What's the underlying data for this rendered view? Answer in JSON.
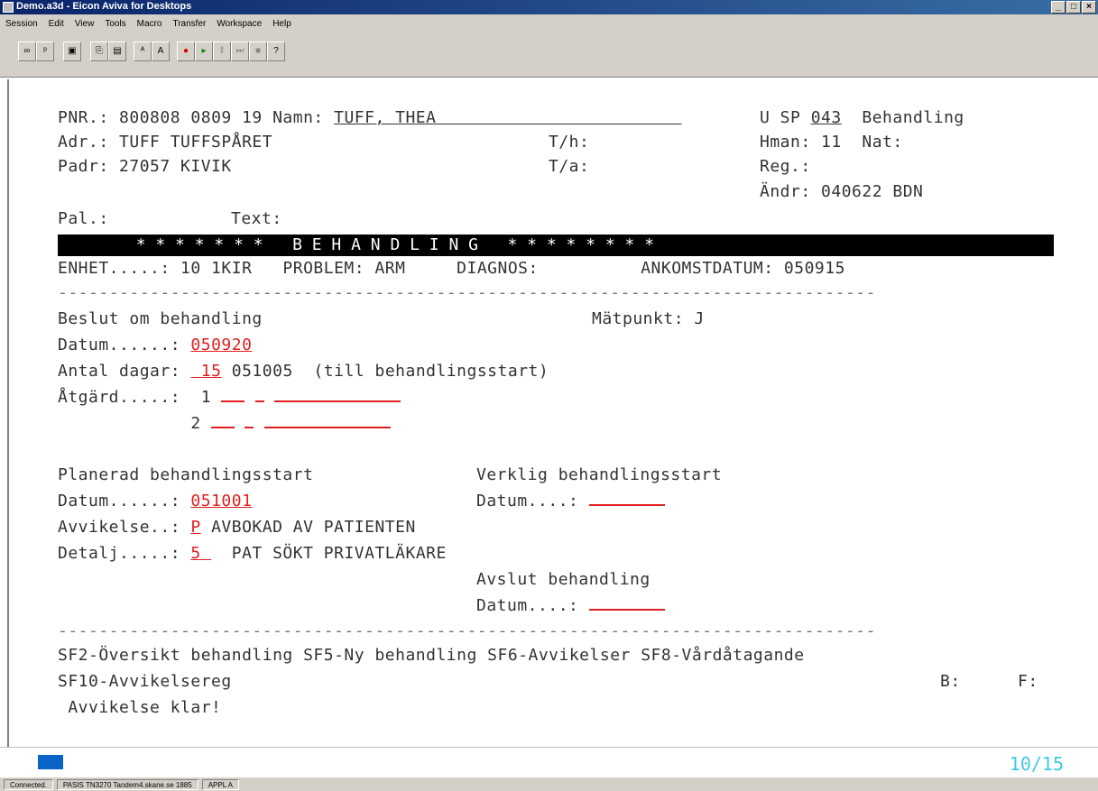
{
  "window": {
    "title": "Demo.a3d - Eicon Aviva for Desktops",
    "btn_min": "_",
    "btn_max": "□",
    "btn_close": "×"
  },
  "menu": [
    "Session",
    "Edit",
    "View",
    "Tools",
    "Macro",
    "Transfer",
    "Workspace",
    "Help"
  ],
  "screen": {
    "pnr_label": "PNR.: ",
    "pnr_value": "800808 0809 19",
    "namn_label": " Namn: ",
    "namn_value": "TUFF, THEA",
    "usp_label": "U SP ",
    "usp_value": "043",
    "behandling_label": "  Behandling",
    "adr": "Adr.: TUFF TUFFSPÅRET",
    "th": "T/h:",
    "hman": "Hman: 11  Nat:",
    "padr": "Padr: 27057 KIVIK",
    "ta": "T/a:",
    "reg": "Reg.:",
    "andr": "Ändr: 040622 BDN",
    "pal": "Pal.:",
    "text": "Text:",
    "band": "        * * * * * * *   B E H A N D L I N G   * * * * * * * *",
    "enhet": "ENHET.....: 10 1KIR   PROBLEM: ARM     DIAGNOS:          ANKOMSTDATUM: 050915",
    "separator": "--------------------------------------------------------------------------------",
    "beslut": "Beslut om behandling",
    "matpunkt": "Mätpunkt: J",
    "datum1_label": "Datum......: ",
    "datum1_value": "050920",
    "antal_label": "Antal dagar: ",
    "antal_value": "15",
    "antal_rest": " 051005  (till behandlingsstart)",
    "atgard_label": "Åtgärd.....:  1 ",
    "atgard2": "             2 ",
    "planerad": "Planerad behandlingsstart",
    "verklig": "Verklig behandlingsstart",
    "datum2_label": "Datum......: ",
    "datum2_value": "051001",
    "datum3_label": "Datum....: ",
    "avvikelse_label": "Avvikelse..: ",
    "avvikelse_value": "P",
    "avvikelse_text": " AVBOKAD AV PATIENTEN",
    "detalj_label": "Detalj.....: ",
    "detalj_value": "5",
    "detalj_text": "  PAT SÖKT PRIVATLÄKARE",
    "avslut": "Avslut behandling",
    "datum4_label": "Datum....: ",
    "sf_line1": "SF2-Översikt behandling SF5-Ny behandling SF6-Avvikelser SF8-Vårdåtagande",
    "sf_line2": "SF10-Avvikelsereg",
    "b_label": "B:",
    "f_label": "F:",
    "message": " Avvikelse klar!"
  },
  "oia": {
    "position": "10/15"
  },
  "status": {
    "connected": "Connected.",
    "session": "PASIS  TN3270  Tandem4.skane.se  1885",
    "mode": "APPL A"
  }
}
